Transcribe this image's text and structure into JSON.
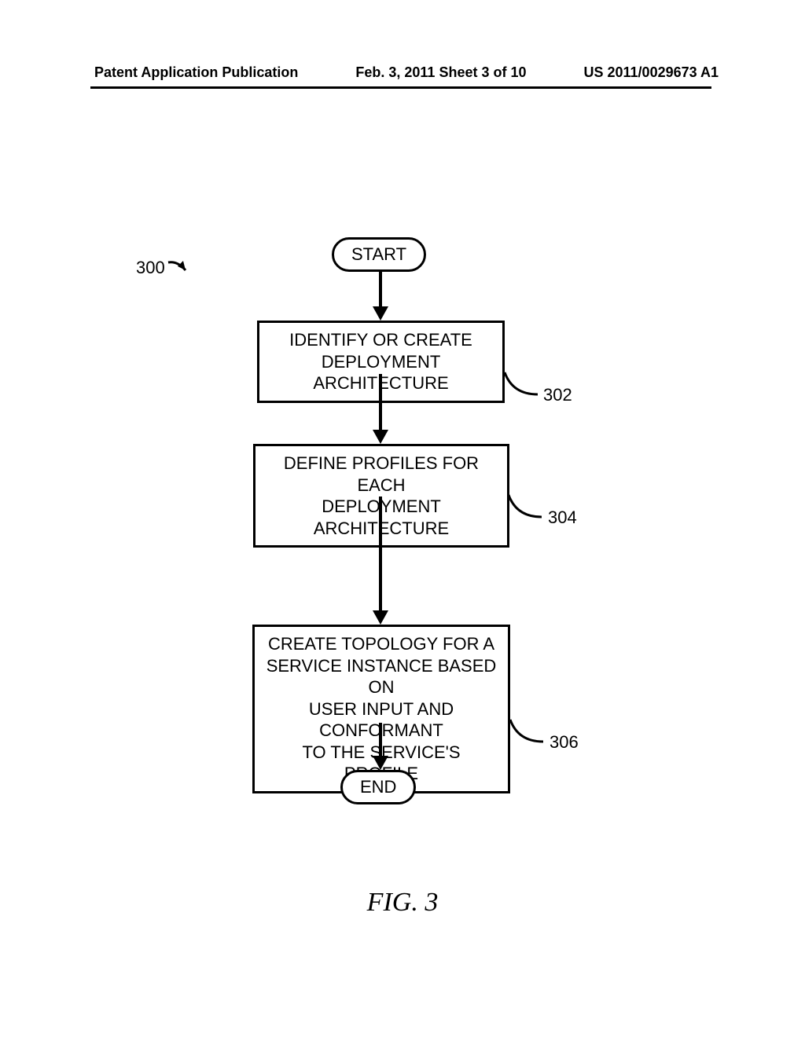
{
  "header": {
    "left": "Patent Application Publication",
    "center": "Feb. 3, 2011  Sheet 3 of 10",
    "right": "US 2011/0029673 A1"
  },
  "flowchart": {
    "ref_main": "300",
    "start": "START",
    "end": "END",
    "boxes": {
      "b302": {
        "line1": "IDENTIFY OR CREATE",
        "line2": "DEPLOYMENT ARCHITECTURE",
        "ref": "302"
      },
      "b304": {
        "line1": "DEFINE PROFILES FOR EACH",
        "line2": "DEPLOYMENT ARCHITECTURE",
        "ref": "304"
      },
      "b306": {
        "line1": "CREATE TOPOLOGY FOR A",
        "line2": "SERVICE INSTANCE BASED ON",
        "line3": "USER INPUT AND CONFORMANT",
        "line4": "TO THE SERVICE'S PROFILE",
        "ref": "306"
      }
    }
  },
  "caption": "FIG. 3"
}
